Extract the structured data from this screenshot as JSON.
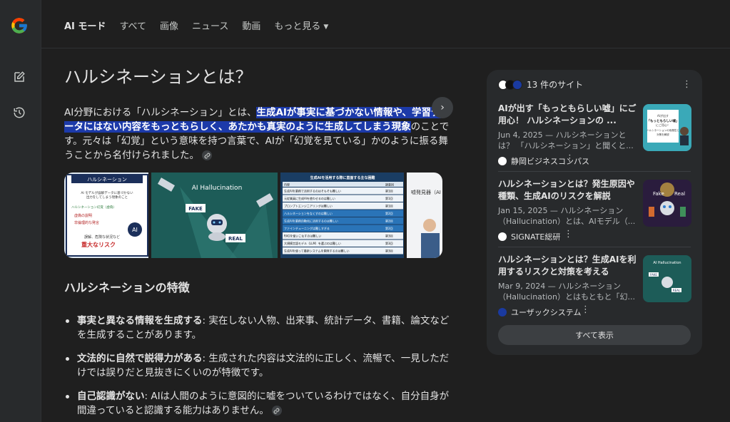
{
  "nav": {
    "tabs": [
      "AI モード",
      "すべて",
      "画像",
      "ニュース",
      "動画",
      "もっと見る"
    ]
  },
  "main": {
    "title": "ハルシネーションとは？",
    "lead_pre": "AI分野における「ハルシネーション」とは、",
    "lead_highlight": "生成AIが事実に基づかない情報や、学習データにはない内容をもっともらしく、あたかも真実のように生成してしまう現象",
    "lead_post": "のことです。元々は「幻覚」という意味を持つ言葉で、AIが「幻覚を見ている」かのように振る舞うことから名付けられました。",
    "carousel": {
      "img1": {
        "header": "ハルシネーション",
        "lines": [
          "AI モデルが誤解データに基づかない",
          "出力をしてしまう現象のこと"
        ],
        "item1": "ハルシネーション幻覚（虚偽）",
        "item2": "虚偽の説明",
        "item3": "非倫理的な発言",
        "item4": "誤解、危険な状況など",
        "risk": "重大なリスク",
        "ai": "AI"
      },
      "img2": {
        "title": "AI Hallucination",
        "fake": "FAKE",
        "real": "REAL"
      },
      "img3": {
        "title": "生成AIを活用する際に直面する主な困難",
        "head_left": "内容",
        "head_right": "調査回",
        "rows": [
          [
            "生成AIを業務で活用するのはそもそも難しい",
            "第1回"
          ],
          [
            "元従業員に生成AIを使わせるのは難しい",
            "第1回"
          ],
          [
            "プロンプトエンジニアリングは難しい",
            "第1回"
          ],
          [
            "ハルシネーションをなくすのは難しい",
            "第2回"
          ],
          [
            "生成AIを業務自動化に活用するのは難しい",
            "第2回"
          ],
          [
            "ファインチューニングは難しすぎる",
            "第2回"
          ],
          [
            "RAGを使いこなすのは難しい",
            "第3回"
          ],
          [
            "大規模言語モデル（LLM）を選ぶのは難しい",
            "第3回"
          ],
          [
            "生成AIを使って最新システムを開発するのは難しい",
            "第3回"
          ]
        ]
      },
      "img4": {
        "label": "嘘発見器（AI"
      }
    },
    "section_title": "ハルシネーションの特徴",
    "bullets": [
      {
        "bold": "事実と異なる情報を生成する",
        "text": ": 実在しない人物、出来事、統計データ、書籍、論文などを生成することがあります。"
      },
      {
        "bold": "文法的に自然で説得力がある",
        "text": ": 生成された内容は文法的に正しく、流暢で、一見しただけでは誤りだと見抜きにくいのが特徴です。"
      },
      {
        "bold": "自己認識がない",
        "text": ": AIは人間のように意図的に嘘をついているわけではなく、自分自身が間違っていると認識する能力はありません。"
      }
    ]
  },
  "panel": {
    "count": "13 件のサイト",
    "sources": [
      {
        "title": "AIが出す「もっともらしい嘘」にご用心！ ハルシネーションの ...",
        "desc": "Jun 4, 2025 — ハルシネーションとは？ 「ハルシネーション」と聞くと...",
        "name": "静岡ビジネスコンパス",
        "thumb": [
          "AIが出す",
          "「もっともらしい嘘」",
          "にご用心！",
          "ハルシネーションの危険性と",
          "対策を解説"
        ],
        "fav_color": "#ffffff"
      },
      {
        "title": "ハルシネーションとは？発生原因や種類、生成AIのリスクを解説",
        "desc": "Jan 15, 2025 — ハルシネーション（Hallucination）とは、AIモデル（...",
        "name": "SIGNATE総研",
        "thumb": [
          "Fake",
          "Real"
        ],
        "fav_color": "#ffffff"
      },
      {
        "title": "ハルシネーションとは？生成AIを利用するリスクと対策を考える",
        "desc": "Mar 9, 2024 — ハルシネーション（Hallucination）とはもともと「幻...",
        "name": "ユーザックシステム",
        "thumb": [
          "AI Hallucination",
          "FAKE",
          "REAL"
        ],
        "fav_color": "#1a3aa0"
      }
    ],
    "show_all": "すべて表示"
  },
  "colors": {
    "background": "#1f1f1f",
    "highlight": "#1c3aa9",
    "panel": "#282a2c"
  }
}
